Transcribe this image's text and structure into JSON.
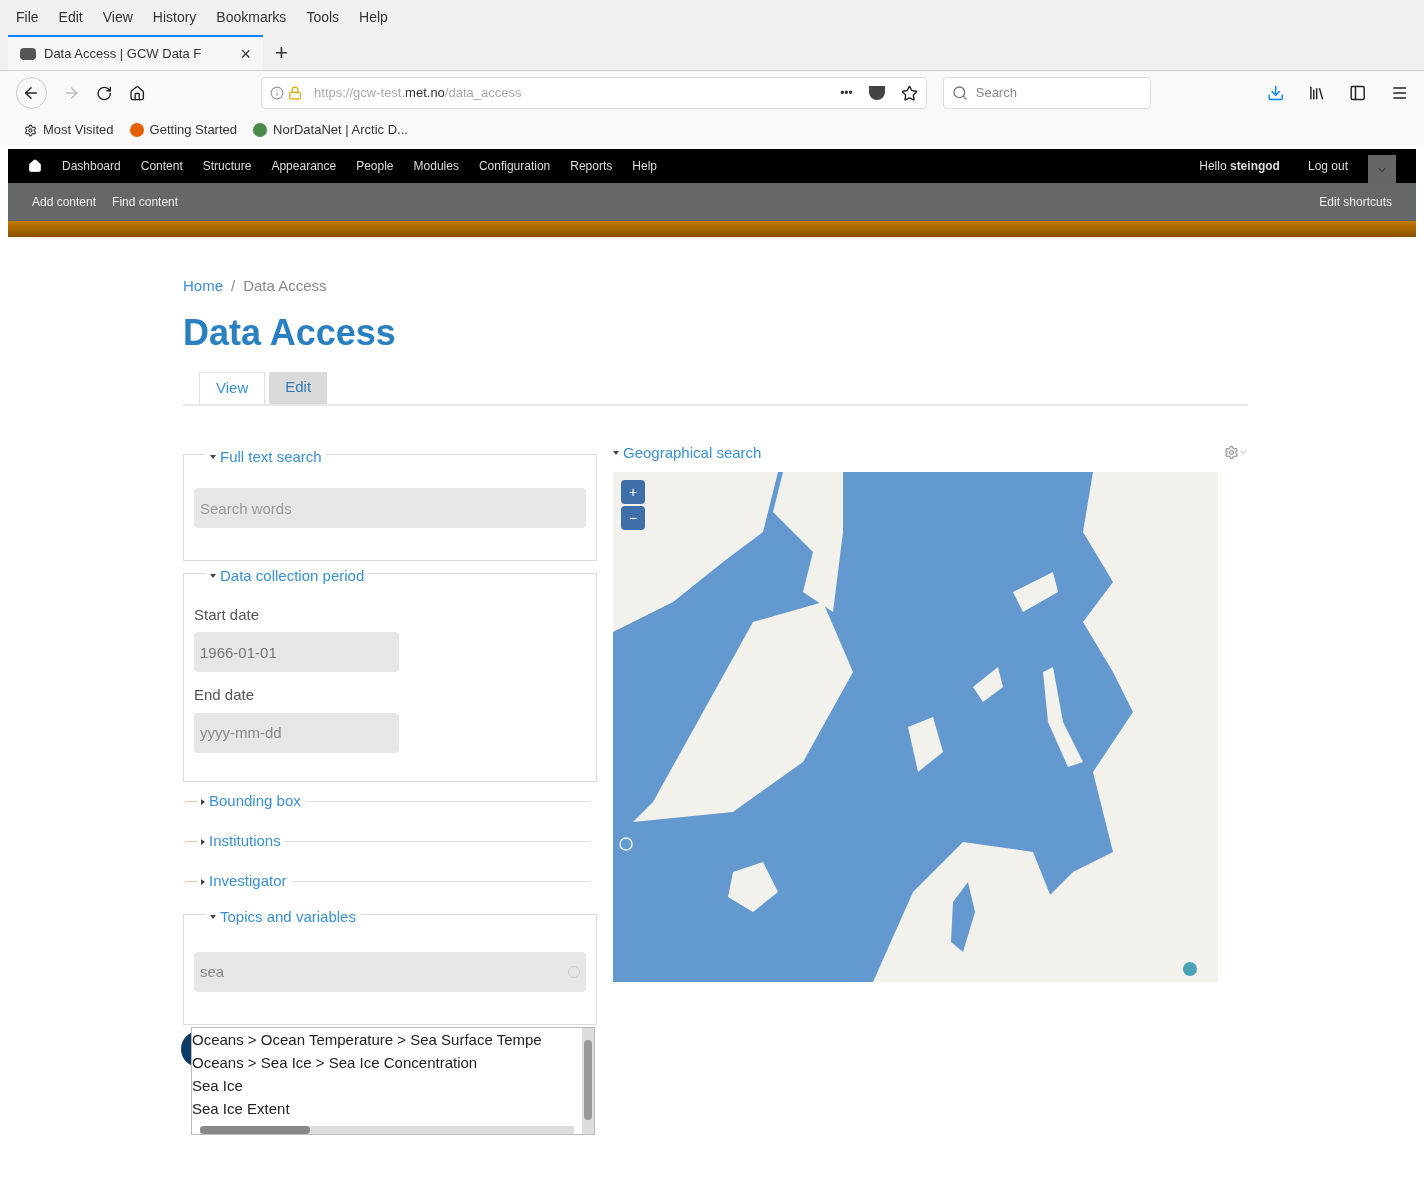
{
  "browser": {
    "menu": [
      "File",
      "Edit",
      "View",
      "History",
      "Bookmarks",
      "Tools",
      "Help"
    ],
    "tab": {
      "title": "Data Access | GCW Data F",
      "close": "×",
      "new": "+"
    },
    "url": {
      "prefix": "https://gcw-test.",
      "domain": "met.no",
      "path": "/data_access"
    },
    "page_actions": "•••",
    "search": {
      "placeholder": "Search"
    },
    "bookmarks": [
      "Most Visited",
      "Getting Started",
      "NorDataNet | Arctic D..."
    ]
  },
  "admin_toolbar": {
    "items": [
      "Dashboard",
      "Content",
      "Structure",
      "Appearance",
      "People",
      "Modules",
      "Configuration",
      "Reports",
      "Help"
    ],
    "greeting": "Hello **steingod**",
    "logout": "Log out",
    "shortcuts": [
      "Add content",
      "Find content"
    ],
    "edit_shortcuts": "Edit shortcuts"
  },
  "breadcrumb": [
    {
      "label": "Home",
      "link": true
    },
    {
      "label": "/",
      "link": false
    },
    {
      "label": "Data Access",
      "link": false
    }
  ],
  "title": "Data Access",
  "tabs": [
    {
      "label": "View",
      "selected": true
    },
    {
      "label": "Edit",
      "selected": false
    }
  ],
  "filters": [
    {
      "kind": "text",
      "legend": "Full text search",
      "expanded": true,
      "placeholder": "Search words"
    },
    {
      "kind": "dates",
      "legend": "Data collection period",
      "expanded": true,
      "fields": [
        {
          "label": "Start date",
          "value": "1966-01-01"
        },
        {
          "label": "End date",
          "placeholder": "yyyy-mm-dd"
        }
      ]
    },
    {
      "kind": "none",
      "legend": "Bounding box",
      "expanded": false
    },
    {
      "kind": "none",
      "legend": "Institutions",
      "expanded": false
    },
    {
      "kind": "none",
      "legend": "Investigator",
      "expanded": false
    },
    {
      "kind": "topics",
      "legend": "Topics and variables",
      "expanded": true,
      "value": "sea",
      "options": [
        "Oceans > Ocean Temperature > Sea Surface Tempe",
        "Oceans > Sea Ice > Sea Ice Concentration",
        "Sea Ice",
        "Sea Ice Extent"
      ]
    }
  ],
  "geo": {
    "legend": "Geographical search",
    "expanded": true,
    "zoom": [
      "+",
      "−"
    ],
    "map": {
      "kind": "picture"
    }
  }
}
